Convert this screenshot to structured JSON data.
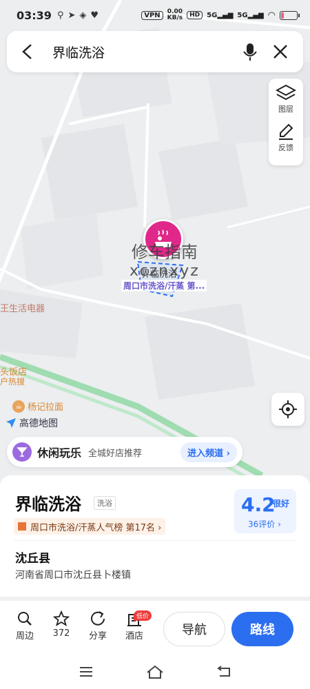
{
  "status_bar": {
    "time": "03:39",
    "vpn": "VPN",
    "net_speed_value": "0.00",
    "net_speed_unit": "KB/s",
    "hd": "HD",
    "sim1": "5G",
    "sim2": "5G",
    "battery_level": 0.15
  },
  "search": {
    "query": "界临洗浴"
  },
  "tools": {
    "layers_label": "图层",
    "feedback_label": "反馈"
  },
  "map": {
    "label_store": "王生活电器",
    "label_restaurant": "头饭店",
    "label_hotsearch": "户热搜",
    "label_noodle": "杨记拉面",
    "poi_name": "界临洗浴",
    "poi_sub": "周口市洗浴/汗蒸 第...",
    "watermark_line1": "修车指南",
    "watermark_line2": "xcznxyz",
    "brand": "高德地图"
  },
  "leisure": {
    "title": "休闲玩乐",
    "subtitle": "全城好店推荐",
    "enter_label": "进入频道 ›"
  },
  "card": {
    "name": "界临洗浴",
    "tag": "洗浴",
    "rank": "周口市洗浴/汗蒸人气榜 第17名 ›",
    "score": "4.2",
    "score_word": "很好",
    "reviews": "36评价 ›",
    "county": "沈丘县",
    "address": "河南省周口市沈丘县卜楼镇"
  },
  "actions": {
    "nearby": "周边",
    "favorites": "372",
    "share": "分享",
    "hotel": "酒店",
    "low_price": "低价",
    "navigate": "导航",
    "route": "路线"
  },
  "colors": {
    "accent": "#2b6ef0",
    "poi": "#e0288a",
    "leisure": "#9b6ae0"
  }
}
